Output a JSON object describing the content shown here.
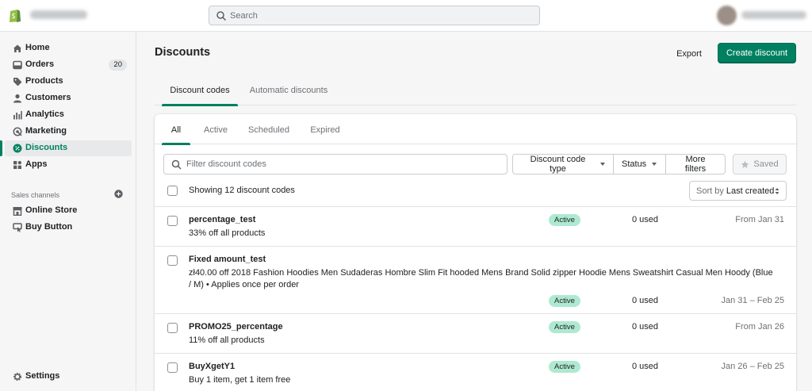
{
  "topbar": {
    "search_placeholder": "Search"
  },
  "sidebar": {
    "items": [
      {
        "label": "Home",
        "icon": "home-icon"
      },
      {
        "label": "Orders",
        "icon": "orders-icon",
        "badge": "20"
      },
      {
        "label": "Products",
        "icon": "tag-icon"
      },
      {
        "label": "Customers",
        "icon": "customer-icon"
      },
      {
        "label": "Analytics",
        "icon": "analytics-icon"
      },
      {
        "label": "Marketing",
        "icon": "marketing-icon"
      },
      {
        "label": "Discounts",
        "icon": "discount-icon",
        "active": true
      },
      {
        "label": "Apps",
        "icon": "apps-icon"
      }
    ],
    "sales_channels_title": "Sales channels",
    "channels": [
      {
        "label": "Online Store",
        "icon": "store-icon"
      },
      {
        "label": "Buy Button",
        "icon": "buy-button-icon"
      }
    ],
    "settings_label": "Settings"
  },
  "page": {
    "title": "Discounts",
    "export_label": "Export",
    "create_label": "Create discount",
    "tabs": [
      "Discount codes",
      "Automatic discounts"
    ]
  },
  "card": {
    "tabs": [
      "All",
      "Active",
      "Scheduled",
      "Expired"
    ],
    "filter_placeholder": "Filter discount codes",
    "filters": {
      "code_type": "Discount code type",
      "status": "Status",
      "more": "More filters",
      "saved": "Saved"
    },
    "showing": "Showing 12 discount codes",
    "sort_prefix": "Sort by",
    "sort_value": "Last created",
    "rows": [
      {
        "code": "percentage_test",
        "desc": "33% off all products",
        "status": "Active",
        "used": "0 used",
        "dates": "From Jan 31"
      },
      {
        "code": "Fixed amount_test",
        "desc": "zł40.00 off 2018 Fashion Hoodies Men Sudaderas Hombre Slim Fit hooded Mens Brand Solid zipper Hoodie Mens Sweatshirt Casual Men Hoody (Blue / M) • Applies once per order",
        "status": "Active",
        "used": "0 used",
        "dates": "Jan 31 – Feb 25"
      },
      {
        "code": "PROMO25_percentage",
        "desc": "11% off all products",
        "status": "Active",
        "used": "0 used",
        "dates": "From Jan 26"
      },
      {
        "code": "BuyXgetY1",
        "desc": "Buy 1 item, get 1 item free",
        "status": "Active",
        "used": "0 used",
        "dates": "Jan 26 – Feb 25"
      }
    ]
  },
  "colors": {
    "accent": "#008060",
    "status_active_bg": "#aee9d1"
  }
}
